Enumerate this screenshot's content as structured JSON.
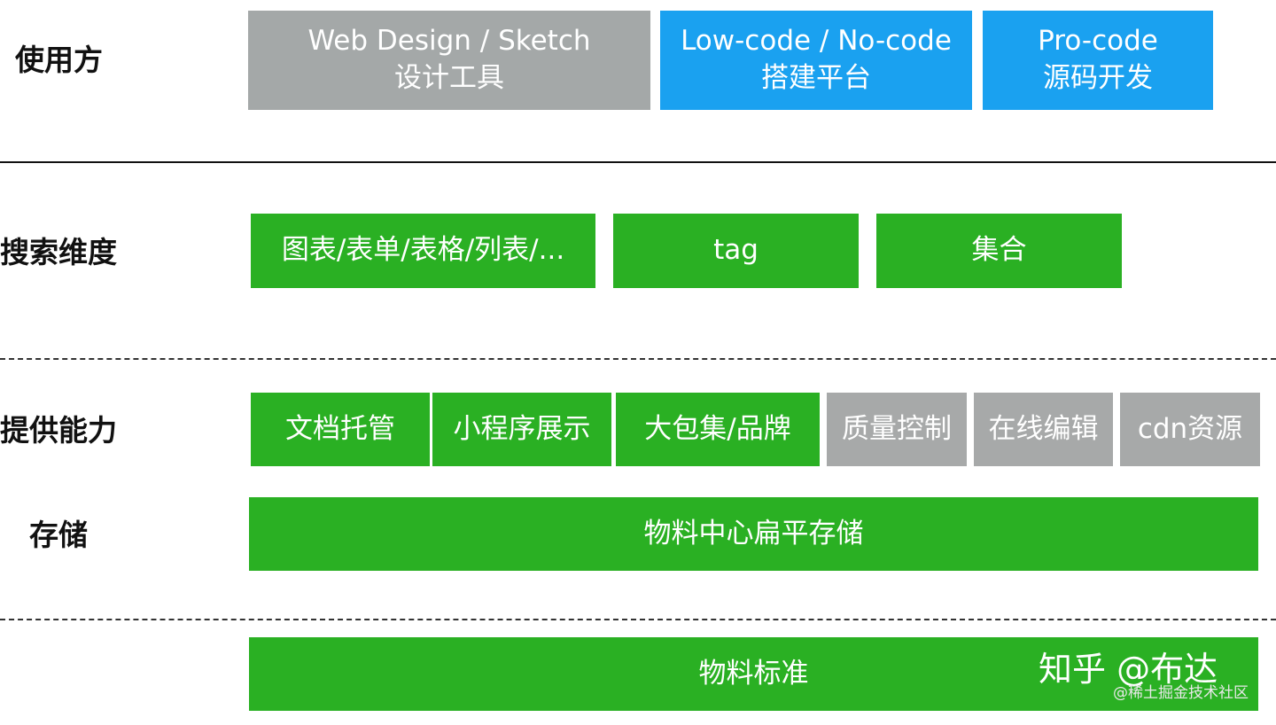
{
  "rows": {
    "users": {
      "label": "使用方",
      "boxes": [
        {
          "line1": "Web Design / Sketch",
          "line2": "设计工具"
        },
        {
          "line1": "Low-code / No-code",
          "line2": "搭建平台"
        },
        {
          "line1": "Pro-code",
          "line2": "源码开发"
        }
      ]
    },
    "search": {
      "label": "搜索维度",
      "boxes": [
        "图表/表单/表格/列表/...",
        "tag",
        "集合"
      ]
    },
    "capability": {
      "label": "提供能力",
      "boxes": [
        "文档托管",
        "小程序展示",
        "大包集/品牌",
        "质量控制",
        "在线编辑",
        "cdn资源"
      ]
    },
    "storage": {
      "label": "存储",
      "box": "物料中心扁平存储"
    },
    "standard": {
      "box": "物料标准"
    }
  },
  "watermark": {
    "main": "知乎 @布达",
    "sub": "@稀土掘金技术社区"
  },
  "colors": {
    "gray": "#a4a8a8",
    "blue": "#1aa1f0",
    "green": "#2ab023",
    "line": "#111111"
  }
}
